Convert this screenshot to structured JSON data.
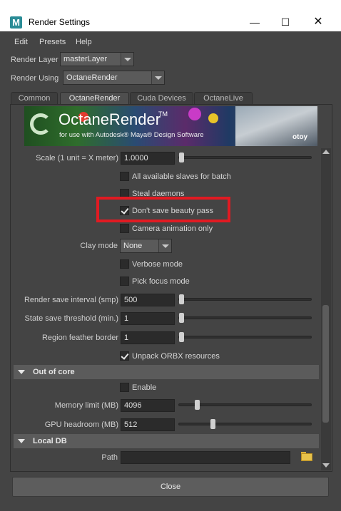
{
  "window": {
    "app_icon_letter": "M",
    "title": "Render Settings",
    "min_glyph": "—",
    "max_glyph": "☐",
    "close_glyph": "✕"
  },
  "menu": [
    "Edit",
    "Presets",
    "Help"
  ],
  "render_layer": {
    "label": "Render Layer",
    "value": "masterLayer"
  },
  "render_using": {
    "label": "Render Using",
    "value": "OctaneRender"
  },
  "tabs": [
    "Common",
    "OctaneRender",
    "Cuda Devices",
    "OctaneLive"
  ],
  "active_tab": "OctaneRender",
  "banner": {
    "brand": "OctaneRender",
    "tm": "TM",
    "subtitle": "for use with Autodesk® Maya® Design Software",
    "vendor": "otoy"
  },
  "scale": {
    "label": "Scale (1 unit = X meter)",
    "value": "1.0000",
    "slider_fraction": 0.0
  },
  "checkboxes_top": [
    {
      "label": "All available slaves for batch",
      "checked": false
    },
    {
      "label": "Steal daemons",
      "checked": false
    },
    {
      "label": "Don't save beauty pass",
      "checked": true
    },
    {
      "label": "Camera animation only",
      "checked": false
    }
  ],
  "clay_mode": {
    "label": "Clay mode",
    "value": "None"
  },
  "checkboxes_mid": [
    {
      "label": "Verbose mode",
      "checked": false
    },
    {
      "label": "Pick focus mode",
      "checked": false
    }
  ],
  "render_save_interval": {
    "label": "Render save interval (smp)",
    "value": "500"
  },
  "state_save_threshold": {
    "label": "State save threshold (min.)",
    "value": "1"
  },
  "region_feather_border": {
    "label": "Region feather border",
    "value": "1"
  },
  "unpack_orbx": {
    "label": "Unpack ORBX resources",
    "checked": true
  },
  "out_of_core": {
    "title": "Out of core",
    "enable": {
      "label": "Enable",
      "checked": false
    },
    "memory_limit": {
      "label": "Memory limit (MB)",
      "value": "4096"
    },
    "gpu_headroom": {
      "label": "GPU headroom (MB)",
      "value": "512"
    }
  },
  "local_db": {
    "title": "Local DB",
    "path_label": "Path",
    "path_value": ""
  },
  "close_button": "Close",
  "colors": {
    "highlight": "#e11a22",
    "panel_bg": "#444444",
    "title_bar": "#ffffff"
  }
}
